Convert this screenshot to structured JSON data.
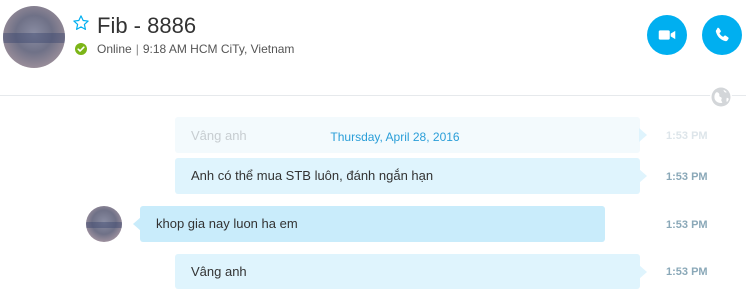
{
  "header": {
    "contact_name": "Fib - 8886",
    "status": "Online",
    "separator": "|",
    "local_time": "9:18 AM HCM CiTy, Vietnam",
    "status_color": "#7cb518",
    "accent_color": "#00aff0",
    "icons": {
      "favorite": "star-outline-icon",
      "video": "video-camera-icon",
      "call": "phone-icon",
      "translate": "globe-icon"
    }
  },
  "conversation": {
    "date_separator": "Thursday, April 28, 2016",
    "messages": [
      {
        "direction": "outgoing",
        "text": "Vâng anh",
        "time": "1:53 PM",
        "faded": true
      },
      {
        "direction": "outgoing",
        "text": "Anh có thể mua STB luôn, đánh ngắn hạn",
        "time": "1:53 PM",
        "faded": false
      },
      {
        "direction": "incoming",
        "text": "khop gia nay luon ha em",
        "time": "1:53 PM",
        "faded": false
      },
      {
        "direction": "outgoing",
        "text": "Vâng anh",
        "time": "1:53 PM",
        "faded": false
      }
    ]
  }
}
